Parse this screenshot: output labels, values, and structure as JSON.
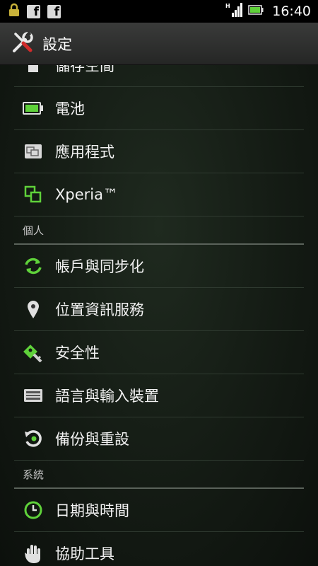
{
  "status_bar": {
    "time": "16:40",
    "left_icons": [
      "lock-icon",
      "facebook-icon",
      "facebook-icon"
    ],
    "right_icons": [
      "hsdpa-signal-icon",
      "battery-icon"
    ]
  },
  "action_bar": {
    "title": "設定",
    "icon": "tools-icon"
  },
  "list": {
    "items": [
      {
        "type": "item",
        "label": "儲存空間",
        "icon": "sd-card-icon"
      },
      {
        "type": "item",
        "label": "電池",
        "icon": "battery-icon"
      },
      {
        "type": "item",
        "label": "應用程式",
        "icon": "apps-icon"
      },
      {
        "type": "item",
        "label": "Xperia™",
        "icon": "xperia-icon"
      },
      {
        "type": "header",
        "label": "個人"
      },
      {
        "type": "item",
        "label": "帳戶與同步化",
        "icon": "sync-icon"
      },
      {
        "type": "item",
        "label": "位置資訊服務",
        "icon": "location-pin-icon"
      },
      {
        "type": "item",
        "label": "安全性",
        "icon": "key-icon"
      },
      {
        "type": "item",
        "label": "語言與輸入裝置",
        "icon": "keyboard-icon"
      },
      {
        "type": "item",
        "label": "備份與重設",
        "icon": "backup-restore-icon"
      },
      {
        "type": "header",
        "label": "系統"
      },
      {
        "type": "item",
        "label": "日期與時間",
        "icon": "clock-icon"
      },
      {
        "type": "item",
        "label": "協助工具",
        "icon": "hand-icon"
      }
    ]
  },
  "colors": {
    "accent_green": "#5fd13a",
    "background": "#141b14",
    "divider": "#2f3a30",
    "header_divider": "#5a625a"
  }
}
